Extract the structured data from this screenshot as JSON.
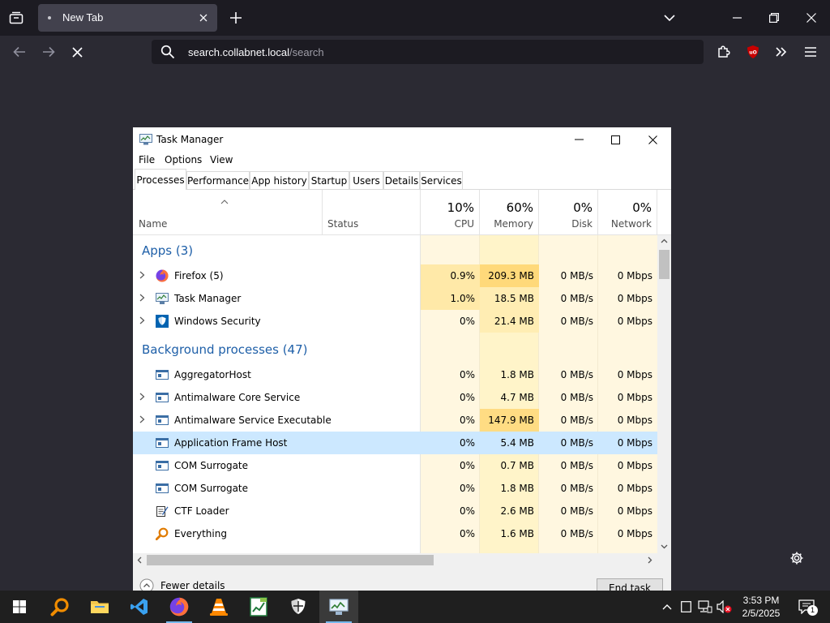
{
  "browser": {
    "tab": {
      "title": "New Tab"
    },
    "url": {
      "host": "search.collabnet.local",
      "path": "/search"
    }
  },
  "task_manager": {
    "title": "Task Manager",
    "menu": [
      "File",
      "Options",
      "View"
    ],
    "tabs": [
      "Processes",
      "Performance",
      "App history",
      "Startup",
      "Users",
      "Details",
      "Services"
    ],
    "columns": {
      "name": "Name",
      "status": "Status",
      "cpu": {
        "pct": "10%",
        "label": "CPU"
      },
      "memory": {
        "pct": "60%",
        "label": "Memory"
      },
      "disk": {
        "pct": "0%",
        "label": "Disk"
      },
      "network": {
        "pct": "0%",
        "label": "Network"
      }
    },
    "groups": {
      "apps": "Apps (3)",
      "background": "Background processes (47)"
    },
    "apps": [
      {
        "name": "Firefox (5)",
        "cpu": "0.9%",
        "memory": "209.3 MB",
        "disk": "0 MB/s",
        "network": "0 Mbps"
      },
      {
        "name": "Task Manager",
        "cpu": "1.0%",
        "memory": "18.5 MB",
        "disk": "0 MB/s",
        "network": "0 Mbps"
      },
      {
        "name": "Windows Security",
        "cpu": "0%",
        "memory": "21.4 MB",
        "disk": "0 MB/s",
        "network": "0 Mbps"
      }
    ],
    "background": [
      {
        "name": "AggregatorHost",
        "cpu": "0%",
        "memory": "1.8 MB",
        "disk": "0 MB/s",
        "network": "0 Mbps"
      },
      {
        "name": "Antimalware Core Service",
        "cpu": "0%",
        "memory": "4.7 MB",
        "disk": "0 MB/s",
        "network": "0 Mbps"
      },
      {
        "name": "Antimalware Service Executable",
        "cpu": "0%",
        "memory": "147.9 MB",
        "disk": "0 MB/s",
        "network": "0 Mbps"
      },
      {
        "name": "Application Frame Host",
        "cpu": "0%",
        "memory": "5.4 MB",
        "disk": "0 MB/s",
        "network": "0 Mbps"
      },
      {
        "name": "COM Surrogate",
        "cpu": "0%",
        "memory": "0.7 MB",
        "disk": "0 MB/s",
        "network": "0 Mbps"
      },
      {
        "name": "COM Surrogate",
        "cpu": "0%",
        "memory": "1.8 MB",
        "disk": "0 MB/s",
        "network": "0 Mbps"
      },
      {
        "name": "CTF Loader",
        "cpu": "0%",
        "memory": "2.6 MB",
        "disk": "0 MB/s",
        "network": "0 Mbps"
      },
      {
        "name": "Everything",
        "cpu": "0%",
        "memory": "1.6 MB",
        "disk": "0 MB/s",
        "network": "0 Mbps"
      }
    ],
    "footer": {
      "fewer_details": "Fewer details",
      "end_task": "End task"
    }
  },
  "taskbar": {
    "time": "3:53 PM",
    "date": "2/5/2025",
    "notification_count": "1"
  }
}
